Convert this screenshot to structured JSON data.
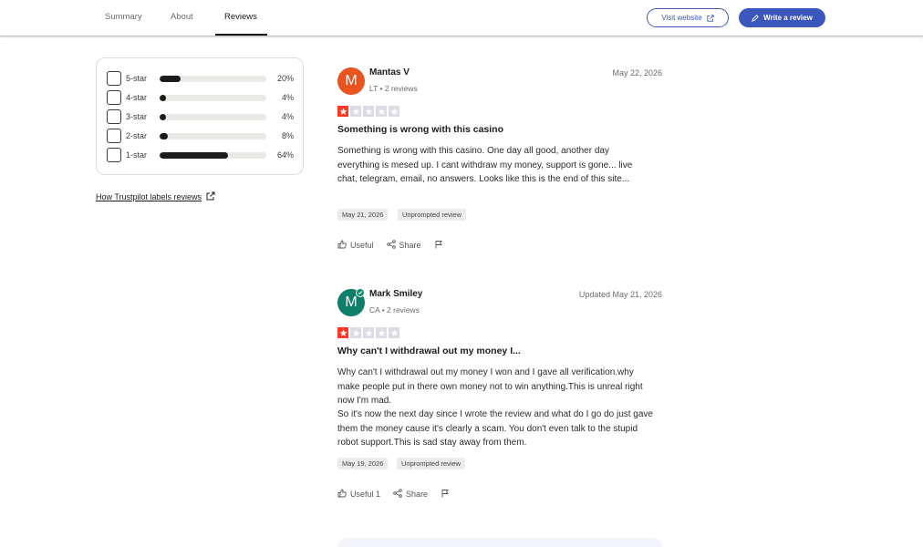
{
  "nav": {
    "tabs": [
      {
        "label": "Summary"
      },
      {
        "label": "About"
      },
      {
        "label": "Reviews",
        "active": true
      }
    ],
    "visit_label": "Visit website",
    "write_label": "Write a review"
  },
  "filter": {
    "rows": [
      {
        "label": "5-star",
        "percent_text": "20%",
        "value": 0.2
      },
      {
        "label": "4-star",
        "percent_text": "4%",
        "value": 0.04
      },
      {
        "label": "3-star",
        "percent_text": "4%",
        "value": 0.04
      },
      {
        "label": "2-star",
        "percent_text": "8%",
        "value": 0.08
      },
      {
        "label": "1-star",
        "percent_text": "64%",
        "value": 0.64
      }
    ],
    "how_link": "How Trustpilot labels reviews"
  },
  "reviews": [
    {
      "avatar_letter": "M",
      "avatar_color": "#e9531f",
      "verified": false,
      "name": "Mantas V",
      "meta": "LT • 2 reviews",
      "date": "May 22, 2026",
      "rating": 1,
      "title": "Something is wrong with this casino",
      "body": "Something is wrong with this casino. One day all good, another day everything is mesed up. I cant withdraw my money, support is gone... live chat, telegram, email, no answers. Looks like this is the end of this site...",
      "experience_date": "May 21, 2026",
      "label": "Unprompted review",
      "useful": "Useful",
      "share": "Share"
    },
    {
      "avatar_letter": "M",
      "avatar_color": "#0e7f68",
      "verified": true,
      "name": "Mark Smiley",
      "meta": "CA • 2 reviews",
      "date": "Updated May 21, 2026",
      "rating": 1,
      "title": "Why can't I withdrawal out my money I...",
      "body": "Why can't I withdrawal out my money I won and I gave all verification.why make people put in there own money not to win anything.This is unreal right now I'm mad.",
      "body2": "So it's now the next day since I wrote the review and what do I go do just gave them the money cause it's clearly a scam. You don't even talk to the stupid robot support.This is sad stay away from them.",
      "experience_date": "May 19, 2026",
      "label": "Unprompted review",
      "useful": "Useful 1",
      "share": "Share"
    }
  ],
  "colors": {
    "accent": "#3c57bc",
    "star_on": "#ff3722",
    "star_off": "#dcdce6"
  }
}
